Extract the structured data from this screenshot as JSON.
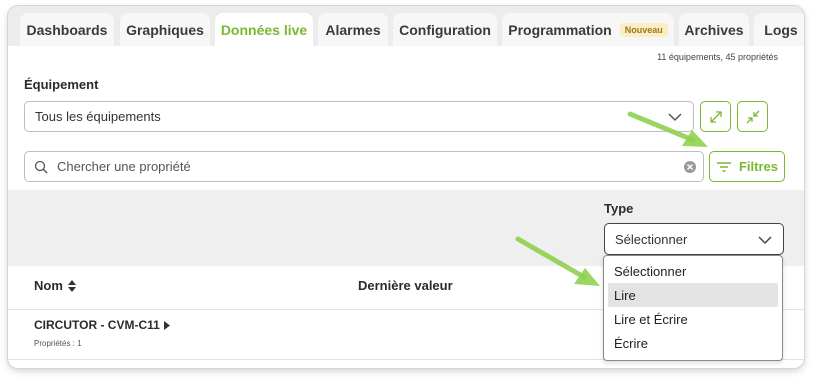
{
  "tabs": [
    {
      "label": "Dashboards",
      "active": false
    },
    {
      "label": "Graphiques",
      "active": false
    },
    {
      "label": "Données live",
      "active": true
    },
    {
      "label": "Alarmes",
      "active": false
    },
    {
      "label": "Configuration",
      "active": false
    },
    {
      "label": "Programmation",
      "active": false,
      "badge": "Nouveau"
    },
    {
      "label": "Archives",
      "active": false
    },
    {
      "label": "Logs",
      "active": false
    }
  ],
  "summary": "11 équipements, 45 propriétés",
  "equipment": {
    "label": "Équipement",
    "selected": "Tous les équipements"
  },
  "search": {
    "placeholder": "Chercher une propriété"
  },
  "filters_label": "Filtres",
  "type_filter": {
    "label": "Type",
    "selected": "Sélectionner",
    "options": [
      "Sélectionner",
      "Lire",
      "Lire et Écrire",
      "Écrire"
    ],
    "highlighted_index": 1
  },
  "table": {
    "columns": [
      "Nom",
      "Dernière valeur"
    ],
    "rows": [
      {
        "name": "CIRCUTOR - CVM-C11",
        "sub": "Propriétés : 1"
      }
    ]
  },
  "colors": {
    "accent": "#7ab832",
    "arrow": "#8fd14f",
    "badge_bg": "#fbeec4"
  },
  "icons": [
    "chevron-down-icon",
    "expand-icon",
    "collapse-icon",
    "search-icon",
    "clear-icon",
    "filter-icon",
    "sort-icon",
    "chevron-right-icon"
  ]
}
